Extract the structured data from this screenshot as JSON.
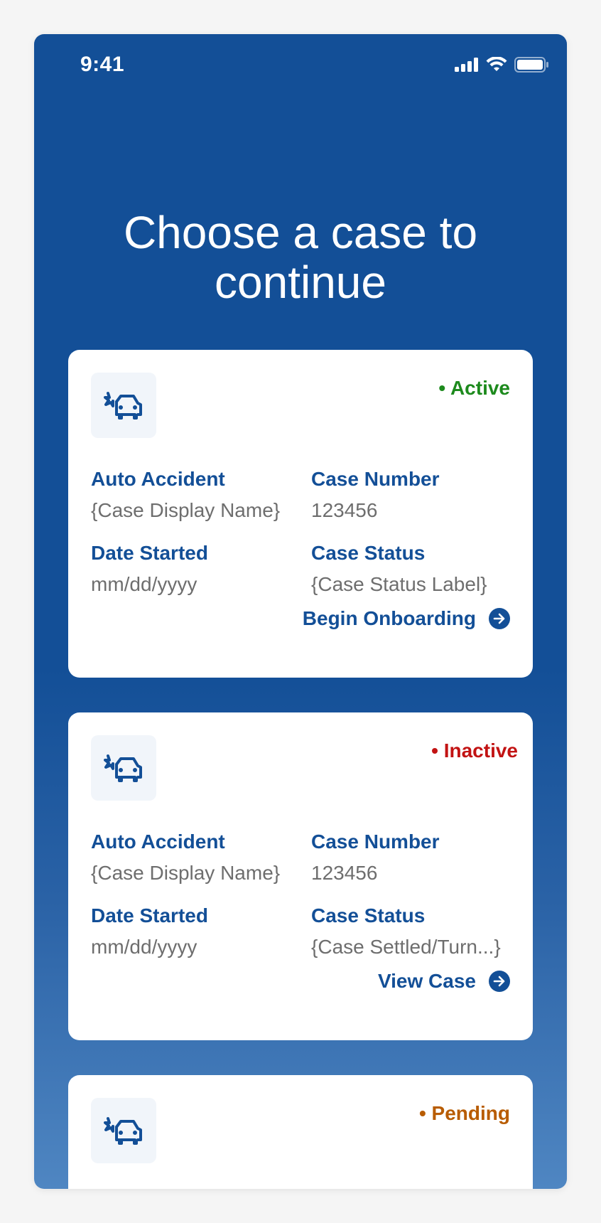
{
  "status_bar": {
    "time": "9:41",
    "icons": [
      "signal-icon",
      "wifi-icon",
      "battery-icon"
    ]
  },
  "page": {
    "title": "Choose a case to continue"
  },
  "colors": {
    "primary": "#134f97",
    "active": "#1d8a1d",
    "inactive": "#c21313",
    "pending": "#b85c00",
    "value_text": "#6e6e6e"
  },
  "cards": [
    {
      "icon": "car-accident-icon",
      "status": "• Active",
      "case_type_label": "Auto Accident",
      "case_type_value": "{Case Display Name}",
      "case_number_label": "Case Number",
      "case_number_value": "123456",
      "date_label": "Date Started",
      "date_value": "mm/dd/yyyy",
      "case_status_label": "Case Status",
      "case_status_value": "{Case Status Label}",
      "action_label": "Begin Onboarding",
      "action_icon": "arrow-right-circle-icon"
    },
    {
      "icon": "car-accident-icon",
      "status": "• Inactive",
      "case_type_label": "Auto Accident",
      "case_type_value": "{Case Display Name}",
      "case_number_label": "Case Number",
      "case_number_value": "123456",
      "date_label": "Date Started",
      "date_value": "mm/dd/yyyy",
      "case_status_label": "Case Status",
      "case_status_value": "{Case Settled/Turn...}",
      "action_label": "View Case",
      "action_icon": "arrow-right-circle-icon"
    },
    {
      "icon": "car-accident-icon",
      "status": "• Pending"
    }
  ]
}
